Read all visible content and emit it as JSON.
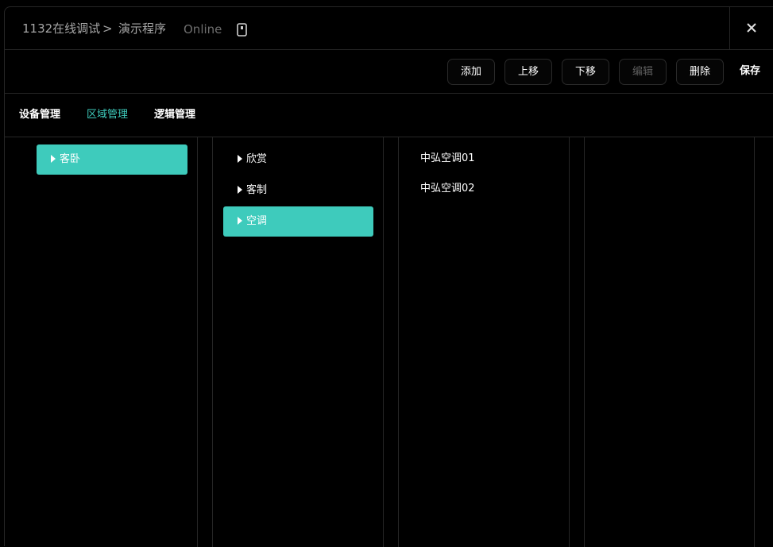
{
  "header": {
    "project": "1132在线调试",
    "separator": ">",
    "program": "演示程序",
    "status": "Online"
  },
  "toolbar": {
    "add": "添加",
    "move_up": "上移",
    "move_down": "下移",
    "edit": "编辑",
    "delete": "删除",
    "save": "保存"
  },
  "tabs": {
    "device": "设备管理",
    "area": "区域管理",
    "logic": "逻辑管理"
  },
  "tree": {
    "col1": [
      "客卧"
    ],
    "col2": [
      "欣赏",
      "客制",
      "空调"
    ],
    "col3": [
      "中弘空调01",
      "中弘空调02"
    ]
  },
  "colors": {
    "accent": "#3ecbbc"
  }
}
